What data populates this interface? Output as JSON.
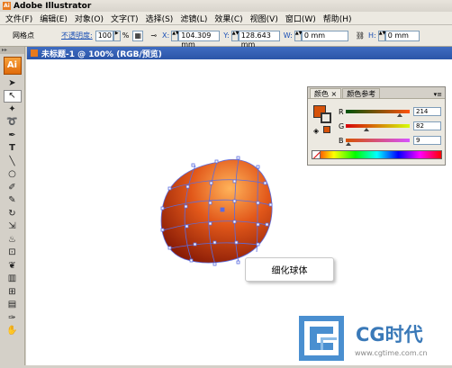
{
  "app": {
    "title": "Adobe Illustrator",
    "icon_text": "Ai"
  },
  "menu": [
    "文件(F)",
    "编辑(E)",
    "对象(O)",
    "文字(T)",
    "选择(S)",
    "滤镜(L)",
    "效果(C)",
    "视图(V)",
    "窗口(W)",
    "帮助(H)"
  ],
  "control_bar": {
    "object_label": "网格点",
    "opacity_label": "不透明度:",
    "opacity_value": "100",
    "opacity_unit": "%",
    "x_label": "X:",
    "x_value": "104.309 mm",
    "y_label": "Y:",
    "y_value": "128.643 mm",
    "w_label": "W:",
    "w_value": "0 mm",
    "h_label": "H:",
    "h_value": "0 mm"
  },
  "document": {
    "tab_title": "未标题-1 @ 100% (RGB/预览)"
  },
  "color_panel": {
    "tabs": [
      "颜色 ×",
      "颜色参考"
    ],
    "menu_icon": "panel-menu-icon",
    "fill_color": "#d6520a",
    "channels": [
      {
        "label": "R",
        "value": "214",
        "fraction": 0.839,
        "gradient": "linear-gradient(to right, #005209, #ff5209)"
      },
      {
        "label": "G",
        "value": "82",
        "fraction": 0.322,
        "gradient": "linear-gradient(to right, #d60009, #d6ff09)"
      },
      {
        "label": "B",
        "value": "9",
        "fraction": 0.035,
        "gradient": "linear-gradient(to right, #d65200, #d652ff)"
      }
    ]
  },
  "tooltip": {
    "text": "细化球体"
  },
  "watermark": {
    "brand": "CG时代",
    "url": "www.cgtime.com.cn"
  },
  "colors": {
    "sphere_light": "#ffb35a",
    "sphere_mid": "#e2581a",
    "sphere_dark": "#8a1c06",
    "mesh": "#5a6be0"
  },
  "tools": [
    "selection-tool",
    "direct-selection-tool",
    "magic-wand-tool",
    "lasso-tool",
    "pen-tool",
    "type-tool",
    "line-tool",
    "ellipse-tool",
    "paintbrush-tool",
    "pencil-tool",
    "rotate-tool",
    "scale-tool",
    "warp-tool",
    "free-transform-tool",
    "symbol-sprayer-tool",
    "column-graph-tool",
    "mesh-tool",
    "gradient-tool",
    "eyedropper-tool",
    "hand-tool"
  ]
}
